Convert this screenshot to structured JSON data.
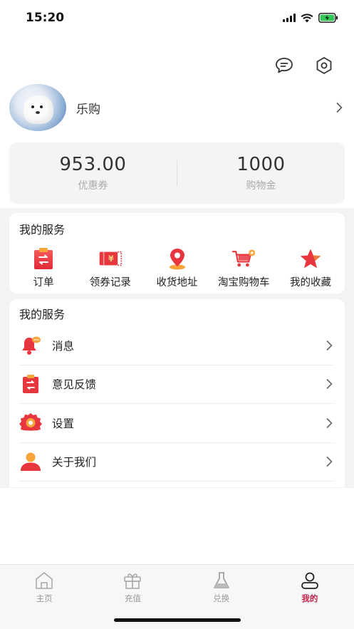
{
  "status_bar": {
    "time": "15:20"
  },
  "top_actions": {
    "message_icon": "chat-bubble-icon",
    "settings_icon": "hexagon-settings-icon"
  },
  "profile": {
    "username": "乐购",
    "avatar_icon": "avatar-dog-photo"
  },
  "wallet": {
    "items": [
      {
        "value": "953.00",
        "label": "优惠券"
      },
      {
        "value": "1000",
        "label": "购物金"
      }
    ]
  },
  "services": {
    "title": "我的服务",
    "items": [
      {
        "label": "订单",
        "icon": "order-icon"
      },
      {
        "label": "领券记录",
        "icon": "coupon-icon"
      },
      {
        "label": "收货地址",
        "icon": "location-pin-icon"
      },
      {
        "label": "淘宝购物车",
        "icon": "cart-icon"
      },
      {
        "label": "我的收藏",
        "icon": "star-icon"
      }
    ]
  },
  "menu": {
    "title": "我的服务",
    "items": [
      {
        "label": "消息",
        "icon": "bell-icon"
      },
      {
        "label": "意见反馈",
        "icon": "feedback-icon"
      },
      {
        "label": "设置",
        "icon": "gear-icon"
      },
      {
        "label": "关于我们",
        "icon": "person-icon"
      }
    ]
  },
  "tabbar": {
    "tabs": [
      {
        "label": "主页",
        "icon": "home-icon"
      },
      {
        "label": "充值",
        "icon": "gift-icon"
      },
      {
        "label": "兑换",
        "icon": "flask-icon"
      },
      {
        "label": "我的",
        "icon": "profile-icon"
      }
    ],
    "active_color": "#c3224b"
  },
  "colors": {
    "accent": "#e8363f",
    "accent_gradient_end": "#f7a53a"
  }
}
